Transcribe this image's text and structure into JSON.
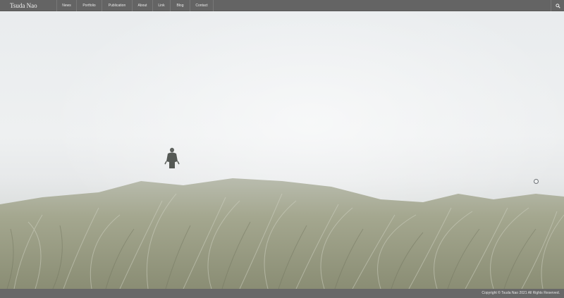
{
  "site": {
    "title": "Tsuda Nao"
  },
  "nav": {
    "items": [
      {
        "label": "News"
      },
      {
        "label": "Portfolio"
      },
      {
        "label": "Publication"
      },
      {
        "label": "About"
      },
      {
        "label": "Link"
      },
      {
        "label": "Blog"
      },
      {
        "label": "Contact"
      }
    ],
    "search_icon": "search-icon"
  },
  "hero": {
    "scene": "foggy grass dune with a lone figure"
  },
  "footer": {
    "copyright": "Copyright © Tsuda Nao 2021 All Rights Reserved."
  },
  "colors": {
    "navbar": "#646464",
    "footer": "#686868",
    "sky": "#eceeef",
    "grass": "#9ea08a"
  }
}
